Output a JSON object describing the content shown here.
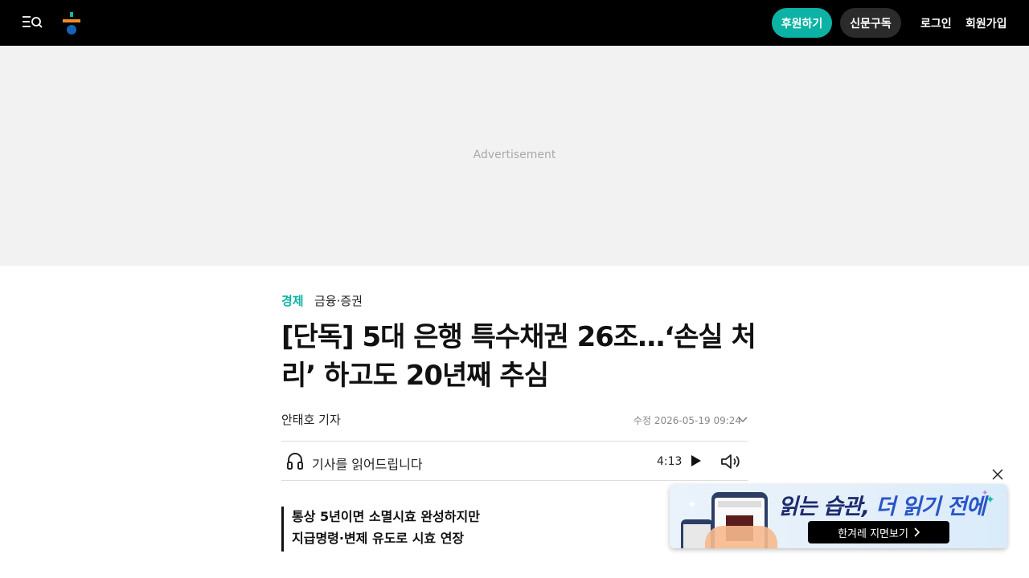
{
  "header": {
    "sponsor_label": "후원하기",
    "subscribe_label": "신문구독",
    "login_label": "로그인",
    "signup_label": "회원가입"
  },
  "ad": {
    "label": "Advertisement"
  },
  "article": {
    "category_main": "경제",
    "category_sub": "금융·증권",
    "title": "[단독] 5대 은행 특수채권 26조…‘손실 처리’ 하고도 20년째 추심",
    "byline": "안태호 기자",
    "modified_date": "수정 2026-05-19 09:24",
    "audio": {
      "label": "기사를 읽어드립니다",
      "duration": "4:13"
    },
    "summary": [
      "통상 5년이면 소멸시효 완성하지만",
      "지급명령·변제 유도로 시효 연장"
    ]
  },
  "promo": {
    "headline_a": "읽는 습관,",
    "headline_b": " 더 읽기 전에",
    "button_label": "한겨레 지면보기"
  },
  "colors": {
    "accent": "#0cb3a5",
    "header_bg": "#000000",
    "ad_bg": "#f2f2f2"
  },
  "icons": [
    "menu-search-icon",
    "logo-icon",
    "chevron-down-icon",
    "headphone-icon",
    "play-icon",
    "volume-icon",
    "close-icon",
    "chevron-right-icon"
  ]
}
